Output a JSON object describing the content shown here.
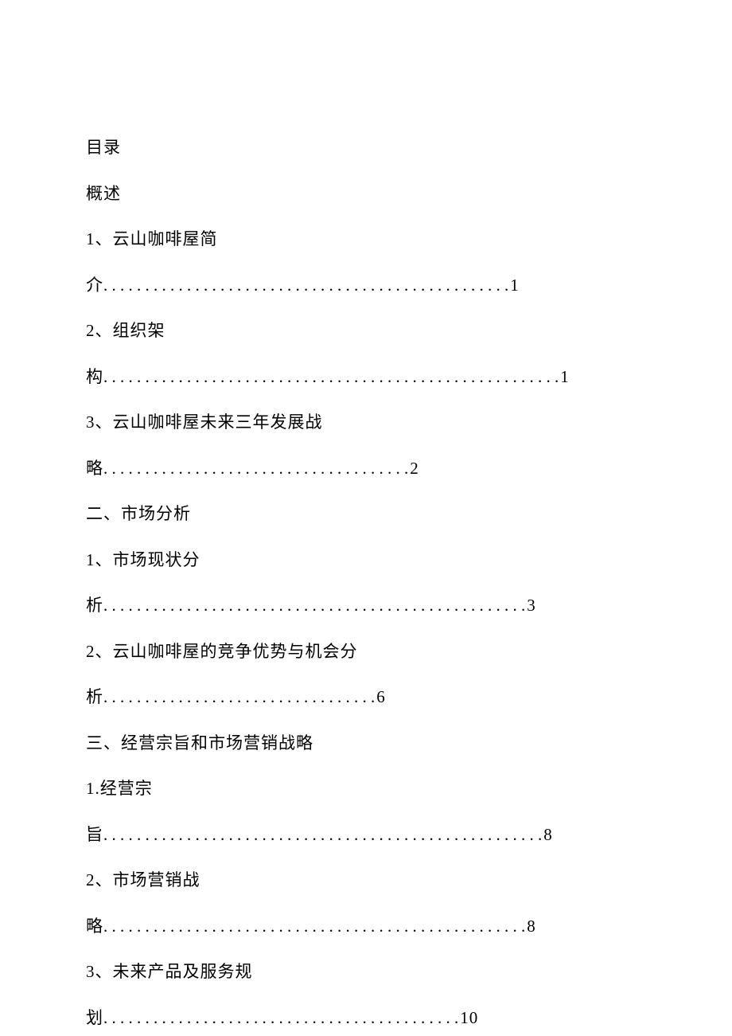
{
  "title": "目录",
  "headings": {
    "overview": "概述",
    "h2": "二、市场分析",
    "h3": "三、经营宗旨和市场营销战略"
  },
  "entries": {
    "e1": {
      "label1": "1、云山咖啡屋简",
      "label2": "介",
      "page": "1",
      "dotCount": 49
    },
    "e2": {
      "label1": "2、组织架",
      "label2": "构",
      "page": "1",
      "dotCount": 55
    },
    "e3": {
      "label1": "3、云山咖啡屋未来三年发展战",
      "label2": "略",
      "page": "2",
      "dotCount": 37
    },
    "e4": {
      "label1": "1、市场现状分",
      "label2": "析",
      "page": "3",
      "dotCount": 51
    },
    "e5": {
      "label1": "2、云山咖啡屋的竞争优势与机会分",
      "label2": "析",
      "page": "6",
      "dotCount": 33
    },
    "e6": {
      "label1": "1.经营宗",
      "label2": "旨",
      "page": "8",
      "dotCount": 53
    },
    "e7": {
      "label1": "2、市场营销战",
      "label2": "略",
      "page": "8",
      "dotCount": 51
    },
    "e8": {
      "label1": "3、未来产品及服务规",
      "label2": "划",
      "page": "10",
      "dotCount": 43
    }
  }
}
